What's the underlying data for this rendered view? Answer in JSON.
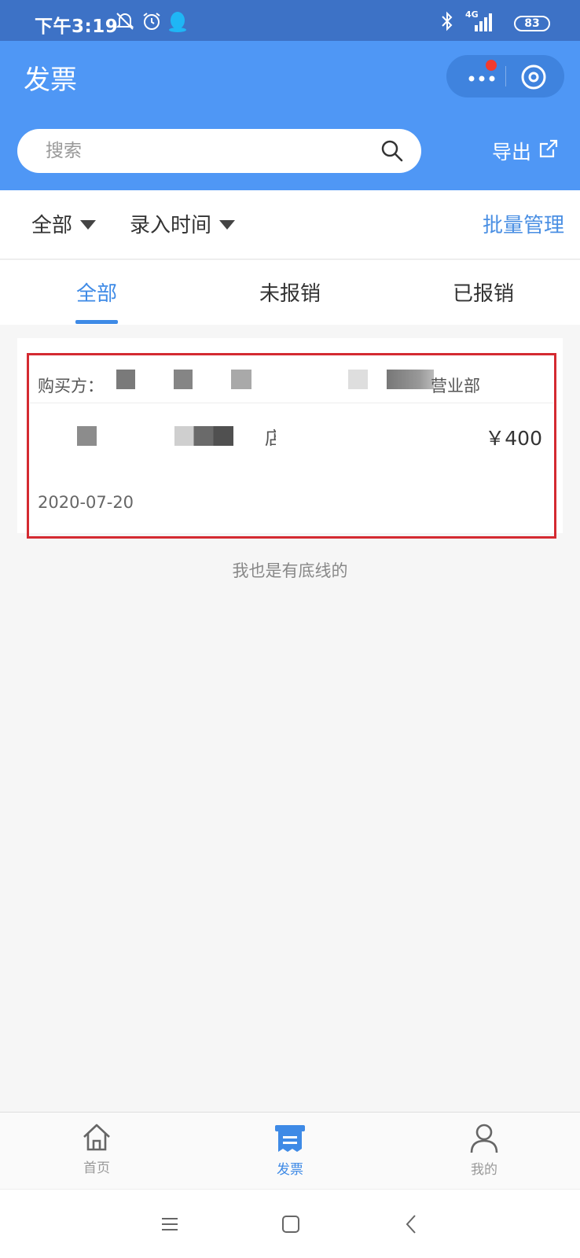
{
  "status_bar": {
    "time": "下午3:19",
    "network": "4G",
    "battery": "83"
  },
  "header": {
    "title": "发票",
    "search_placeholder": "搜索",
    "export_label": "导出",
    "accent_color": "#4f97f5"
  },
  "filters": {
    "category_label": "全部",
    "sort_label": "录入时间",
    "batch_label": "批量管理"
  },
  "tabs": [
    {
      "label": "全部",
      "active": true
    },
    {
      "label": "未报销",
      "active": false
    },
    {
      "label": "已报销",
      "active": false
    }
  ],
  "invoice": {
    "buyer_label": "购买方：",
    "buyer_suffix": "营业部",
    "seller_tail": "店",
    "amount": "￥400",
    "date": "2020-07-20"
  },
  "list_end_text": "我也是有底线的",
  "bottom_nav": [
    {
      "label": "首页",
      "icon": "home-icon",
      "active": false
    },
    {
      "label": "发票",
      "icon": "invoice-icon",
      "active": true
    },
    {
      "label": "我的",
      "icon": "profile-icon",
      "active": false
    }
  ]
}
